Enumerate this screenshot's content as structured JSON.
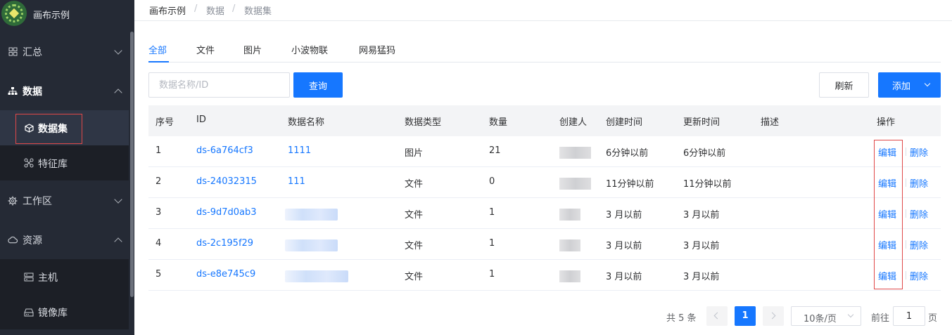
{
  "app": {
    "title": "画布示例"
  },
  "sidebar": {
    "items": [
      {
        "label": "汇总",
        "icon": "grid-icon"
      },
      {
        "label": "数据",
        "icon": "hierarchy-icon"
      },
      {
        "label": "数据集",
        "icon": "cube-icon"
      },
      {
        "label": "特征库",
        "icon": "molecule-icon"
      },
      {
        "label": "工作区",
        "icon": "gear-icon"
      },
      {
        "label": "资源",
        "icon": "cloud-icon"
      },
      {
        "label": "主机",
        "icon": "server-icon"
      },
      {
        "label": "镜像库",
        "icon": "disk-icon"
      }
    ]
  },
  "breadcrumb": [
    "画布示例",
    "数据",
    "数据集"
  ],
  "tabs": [
    "全部",
    "文件",
    "图片",
    "小波物联",
    "网易猛犸"
  ],
  "toolbar": {
    "search_placeholder": "数据名称/ID",
    "query_label": "查询",
    "refresh_label": "刷新",
    "add_label": "添加"
  },
  "table": {
    "columns": [
      "序号",
      "ID",
      "数据名称",
      "数据类型",
      "数量",
      "创建人",
      "创建时间",
      "更新时间",
      "描述",
      "操作"
    ],
    "rows": [
      {
        "index": "1",
        "id": "ds-6a764cf3",
        "name": "1111",
        "type": "图片",
        "count": "21",
        "created": "6分钟以前",
        "updated": "6分钟以前",
        "edit": "编辑",
        "delete": "删除"
      },
      {
        "index": "2",
        "id": "ds-24032315",
        "name": "111",
        "type": "文件",
        "count": "0",
        "created": "11分钟以前",
        "updated": "11分钟以前",
        "edit": "编辑",
        "delete": "删除"
      },
      {
        "index": "3",
        "id": "ds-9d7d0ab3",
        "name": "",
        "type": "文件",
        "count": "1",
        "created": "3 月以前",
        "updated": "3 月以前",
        "edit": "编辑",
        "delete": "删除"
      },
      {
        "index": "4",
        "id": "ds-2c195f29",
        "name": "",
        "type": "文件",
        "count": "1",
        "created": "3 月以前",
        "updated": "3 月以前",
        "edit": "编辑",
        "delete": "删除"
      },
      {
        "index": "5",
        "id": "ds-e8e745c9",
        "name": "",
        "type": "文件",
        "count": "1",
        "created": "3 月以前",
        "updated": "3 月以前",
        "edit": "编辑",
        "delete": "删除"
      }
    ]
  },
  "pagination": {
    "total": "共 5 条",
    "current": "1",
    "page_size": "10条/页",
    "goto_label": "前往",
    "goto_value": "1",
    "page_label": "页"
  },
  "colors": {
    "accent": "#1677ff",
    "sidebar_bg": "#252a35",
    "highlight": "#e04848"
  }
}
